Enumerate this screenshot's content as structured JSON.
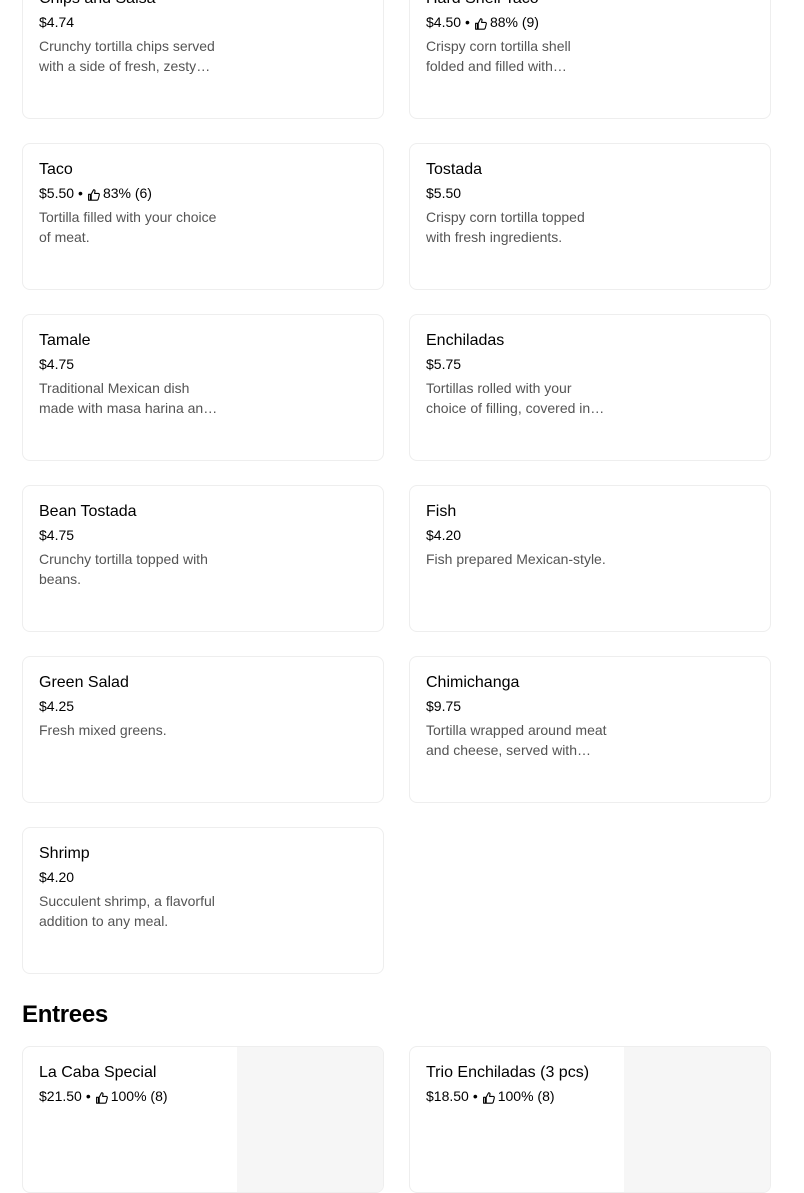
{
  "items": [
    {
      "name": "Chips and Salsa",
      "price": "$4.74",
      "rating": "",
      "description": "Crunchy tortilla chips served with a side of fresh, zesty salsa."
    },
    {
      "name": "Hard Shell Taco",
      "price": "$4.50",
      "rating": "88% (9)",
      "description": "Crispy corn tortilla shell folded and filled with seasoned meat and toppings."
    },
    {
      "name": "Taco",
      "price": "$5.50",
      "rating": "83% (6)",
      "description": "Tortilla filled with your choice of meat."
    },
    {
      "name": "Tostada",
      "price": "$5.50",
      "rating": "",
      "description": "Crispy corn tortilla topped with fresh ingredients."
    },
    {
      "name": "Tamale",
      "price": "$4.75",
      "rating": "",
      "description": "Traditional Mexican dish made with masa harina and filling."
    },
    {
      "name": "Enchiladas",
      "price": "$5.75",
      "rating": "",
      "description": "Tortillas rolled with your choice of filling, covered in sauce."
    },
    {
      "name": "Bean Tostada",
      "price": "$4.75",
      "rating": "",
      "description": "Crunchy tortilla topped with beans."
    },
    {
      "name": "Fish",
      "price": "$4.20",
      "rating": "",
      "description": "Fish prepared Mexican-style."
    },
    {
      "name": "Green Salad",
      "price": "$4.25",
      "rating": "",
      "description": "Fresh mixed greens."
    },
    {
      "name": "Chimichanga",
      "price": "$9.75",
      "rating": "",
      "description": "Tortilla wrapped around meat and cheese, served with toppings."
    },
    {
      "name": "Shrimp",
      "price": "$4.20",
      "rating": "",
      "description": "Succulent shrimp, a flavorful addition to any meal."
    }
  ],
  "entrees": {
    "title": "Entrees",
    "items": [
      {
        "name": "La Caba Special",
        "price": "$21.50",
        "rating": "100% (8)"
      },
      {
        "name": "Trio Enchiladas (3 pcs)",
        "price": "$18.50",
        "rating": "100% (8)"
      }
    ]
  },
  "colors": {
    "text": "#000000",
    "muted": "#545454",
    "border": "#eeeeee",
    "image_placeholder": "#f6f6f6"
  },
  "icons": {
    "rating": "thumbs-up-icon"
  }
}
